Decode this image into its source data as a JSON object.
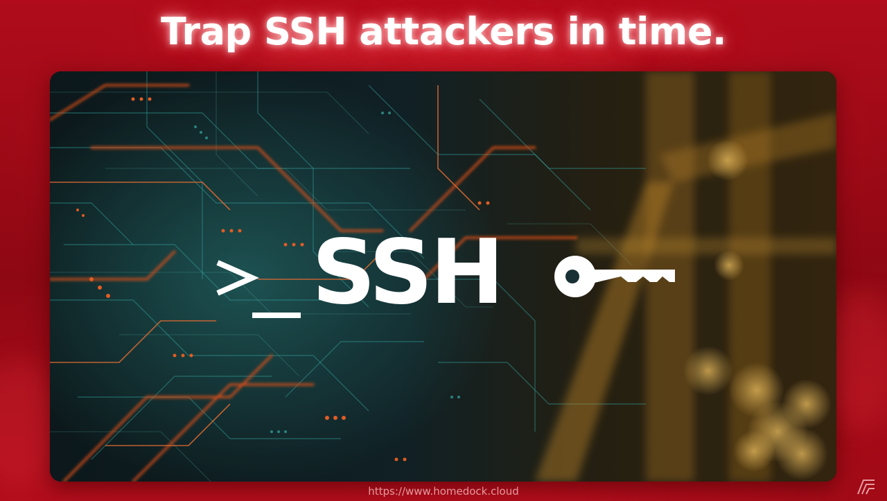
{
  "headline": "Trap SSH attackers in time.",
  "hero": {
    "logo_text": "SSH",
    "prompt_icon": "terminal-prompt-icon",
    "key_icon": "key-icon",
    "image_description": "circuit-board"
  },
  "footer": {
    "url": "https://www.homedock.cloud",
    "logo_icon": "homedock-logo-icon"
  },
  "colors": {
    "background_red": "#b00c1b",
    "circuit_teal": "#2aa6a0",
    "circuit_orange": "#ff5a1f",
    "bokeh_gold": "#e6a23c",
    "logo_white": "#ffffff"
  }
}
